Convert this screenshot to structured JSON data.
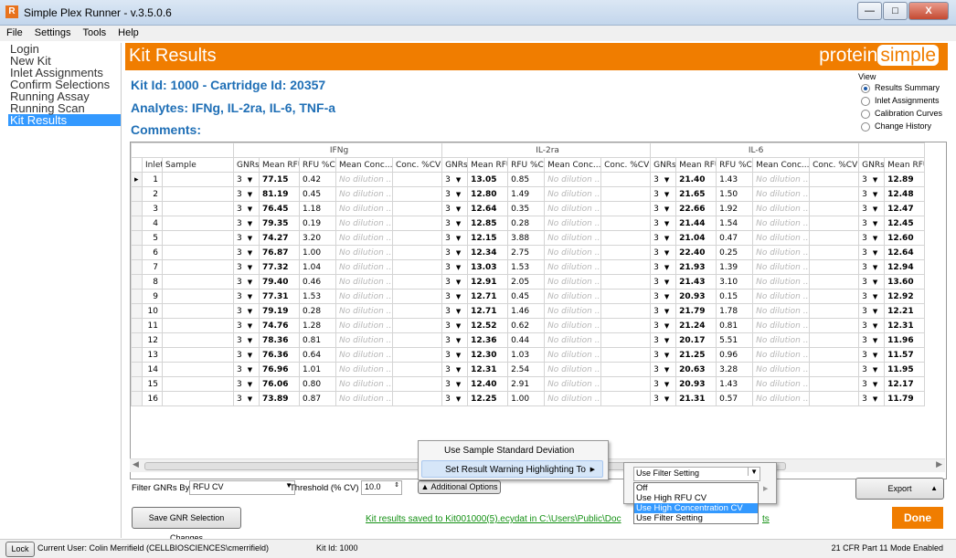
{
  "window": {
    "title": "Simple Plex Runner - v.3.5.0.6",
    "min": "—",
    "max": "□",
    "close": "X"
  },
  "menu": [
    "File",
    "Settings",
    "Tools",
    "Help"
  ],
  "nav": [
    "Login",
    "New Kit",
    "Inlet Assignments",
    "Confirm Selections",
    "Running Assay",
    "Running Scan",
    "Kit Results"
  ],
  "nav_active": 6,
  "header": {
    "title": "Kit Results",
    "logo_a": "protein",
    "logo_b": "simple"
  },
  "kit_line": "Kit Id: 1000 - Cartridge Id: 20357",
  "analytes_line": "Analytes:  IFNg, IL-2ra, IL-6, TNF-a",
  "comments_line": "Comments:",
  "view": {
    "title": "View",
    "options": [
      "Results Summary",
      "Inlet Assignments",
      "Calibration Curves",
      "Change History"
    ],
    "selected": 0
  },
  "grid": {
    "groups": [
      "IFNg",
      "IL-2ra",
      "IL-6"
    ],
    "headers": [
      "Inlet",
      "Sample",
      "GNRs",
      "Mean RFU",
      "RFU %CV",
      "Mean Conc...",
      "Conc. %CV",
      "GNRs",
      "Mean RFU",
      "RFU %CV",
      "Mean Conc...",
      "Conc. %CV",
      "GNRs",
      "Mean RFU",
      "RFU %CV",
      "Mean Conc...",
      "Conc. %CV",
      "GNRs",
      "Mean RFU"
    ],
    "gnr_value": "3",
    "no_dilution": "No dilution ...",
    "rows": [
      [
        "1",
        "77.15",
        "0.42",
        "13.05",
        "0.85",
        "21.40",
        "1.43",
        "12.89"
      ],
      [
        "2",
        "81.19",
        "0.45",
        "12.80",
        "1.49",
        "21.65",
        "1.50",
        "12.48"
      ],
      [
        "3",
        "76.45",
        "1.18",
        "12.64",
        "0.35",
        "22.66",
        "1.92",
        "12.47"
      ],
      [
        "4",
        "79.35",
        "0.19",
        "12.85",
        "0.28",
        "21.44",
        "1.54",
        "12.45"
      ],
      [
        "5",
        "74.27",
        "3.20",
        "12.15",
        "3.88",
        "21.04",
        "0.47",
        "12.60"
      ],
      [
        "6",
        "76.87",
        "1.00",
        "12.34",
        "2.75",
        "22.40",
        "0.25",
        "12.64"
      ],
      [
        "7",
        "77.32",
        "1.04",
        "13.03",
        "1.53",
        "21.93",
        "1.39",
        "12.94"
      ],
      [
        "8",
        "79.40",
        "0.46",
        "12.91",
        "2.05",
        "21.43",
        "3.10",
        "13.60"
      ],
      [
        "9",
        "77.31",
        "1.53",
        "12.71",
        "0.45",
        "20.93",
        "0.15",
        "12.92"
      ],
      [
        "10",
        "79.19",
        "0.28",
        "12.71",
        "1.46",
        "21.79",
        "1.78",
        "12.21"
      ],
      [
        "11",
        "74.76",
        "1.28",
        "12.52",
        "0.62",
        "21.24",
        "0.81",
        "12.31"
      ],
      [
        "12",
        "78.36",
        "0.81",
        "12.36",
        "0.44",
        "20.17",
        "5.51",
        "11.96"
      ],
      [
        "13",
        "76.36",
        "0.64",
        "12.30",
        "1.03",
        "21.25",
        "0.96",
        "11.57"
      ],
      [
        "14",
        "76.96",
        "1.01",
        "12.31",
        "2.54",
        "20.63",
        "3.28",
        "11.95"
      ],
      [
        "15",
        "76.06",
        "0.80",
        "12.40",
        "2.91",
        "20.93",
        "1.43",
        "12.17"
      ],
      [
        "16",
        "73.89",
        "0.87",
        "12.25",
        "1.00",
        "21.31",
        "0.57",
        "11.79"
      ]
    ]
  },
  "filter": {
    "label": "Filter GNRs By:",
    "value": "RFU CV",
    "threshold_label": "Threshold (% CV)",
    "threshold_value": "10.0"
  },
  "additional_options": "Additional Options",
  "save_button": "Save GNR Selection Changes",
  "export_button": "Export",
  "done_button": "Done",
  "saved_link": "Kit results saved to Kit001000(5).ecydat in C:\\Users\\Public\\Doc",
  "saved_link_tail": "ts",
  "context_menu": {
    "item1": "Use Sample Standard Deviation",
    "item2": "Set Result Warning Highlighting To",
    "arrow": "▶"
  },
  "warning_combo": {
    "value": "Use Filter Setting",
    "options": [
      "Off",
      "Use High RFU CV",
      "Use High Concentration CV",
      "Use Filter Setting"
    ],
    "selected": 2
  },
  "status": {
    "lock": "Lock",
    "user": "Current User: Colin Merrifield (CELLBIOSCIENCES\\cmerrifield)",
    "kit": "Kit Id: 1000",
    "mode": "21 CFR Part 11 Mode Enabled"
  }
}
